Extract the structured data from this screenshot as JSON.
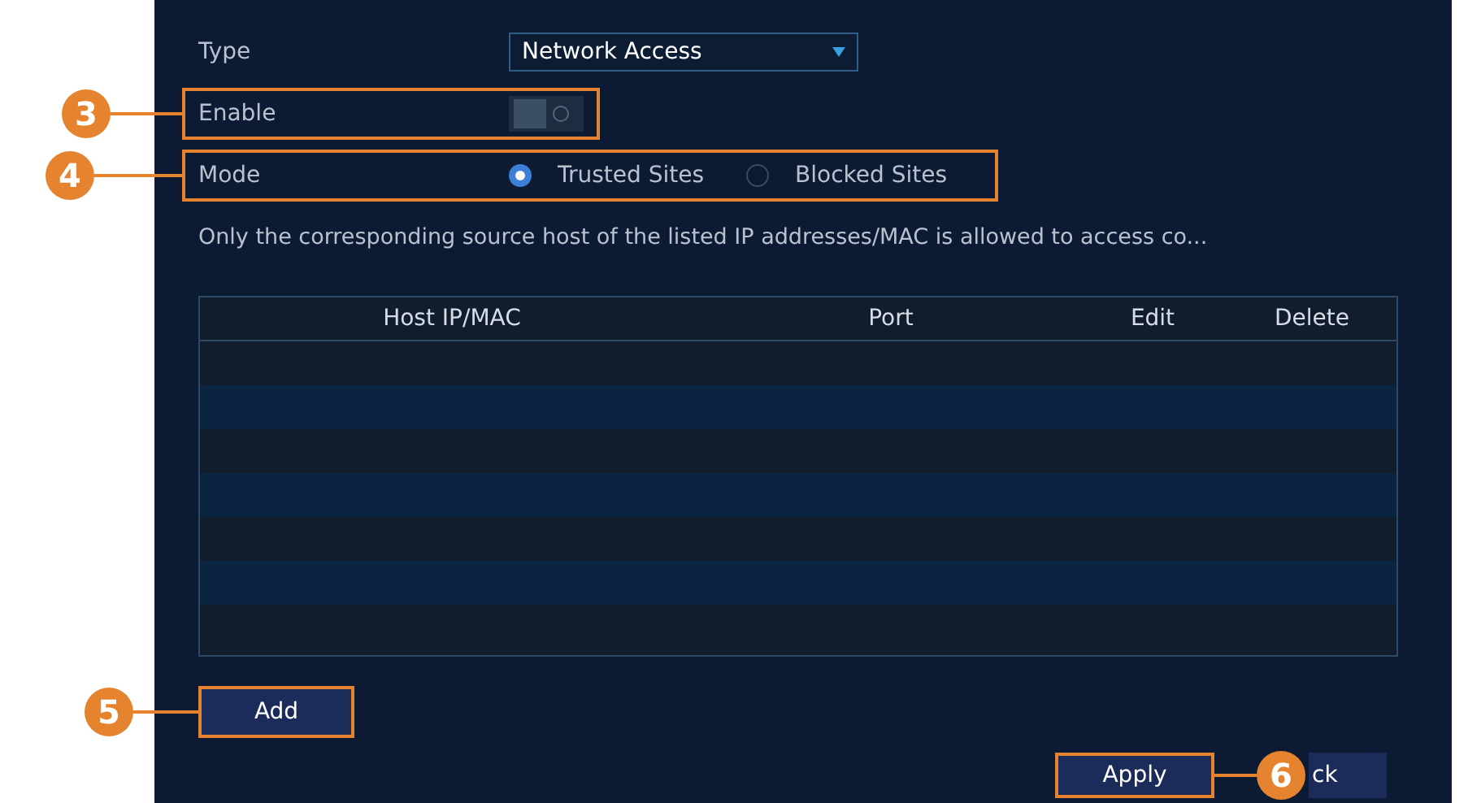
{
  "fields": [
    {
      "kind": "dropdown",
      "label": "Type",
      "value": "Network Access"
    },
    {
      "kind": "toggle",
      "label": "Enable",
      "on": false,
      "callout": "3"
    },
    {
      "kind": "radio",
      "label": "Mode",
      "callout": "4",
      "options": [
        {
          "label": "Trusted Sites",
          "selected": true
        },
        {
          "label": "Blocked Sites",
          "selected": false
        }
      ]
    }
  ],
  "description": "Only the corresponding source host of the listed IP addresses/MAC is allowed to access co...",
  "table": {
    "columns": [
      "Host IP/MAC",
      "Port",
      "Edit",
      "Delete"
    ]
  },
  "add_button": {
    "label": "Add",
    "callout": "5"
  },
  "footer_buttons": [
    {
      "label": "Apply",
      "callout": "6"
    },
    {
      "label": "ck"
    }
  ]
}
